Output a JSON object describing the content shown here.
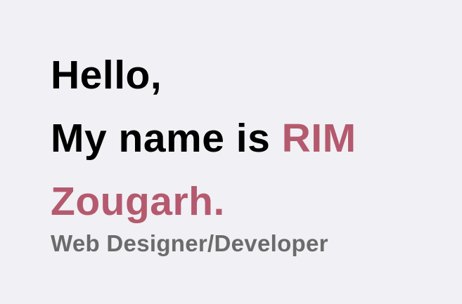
{
  "hero": {
    "greeting": "Hello,",
    "intro": "My name is",
    "first_name": "RIM",
    "last_name": "Zougarh.",
    "role": "Web Designer/Developer"
  },
  "colors": {
    "background": "#f0f0f5",
    "accent": "#b55a6e",
    "subtitle": "#6b6b6b"
  }
}
